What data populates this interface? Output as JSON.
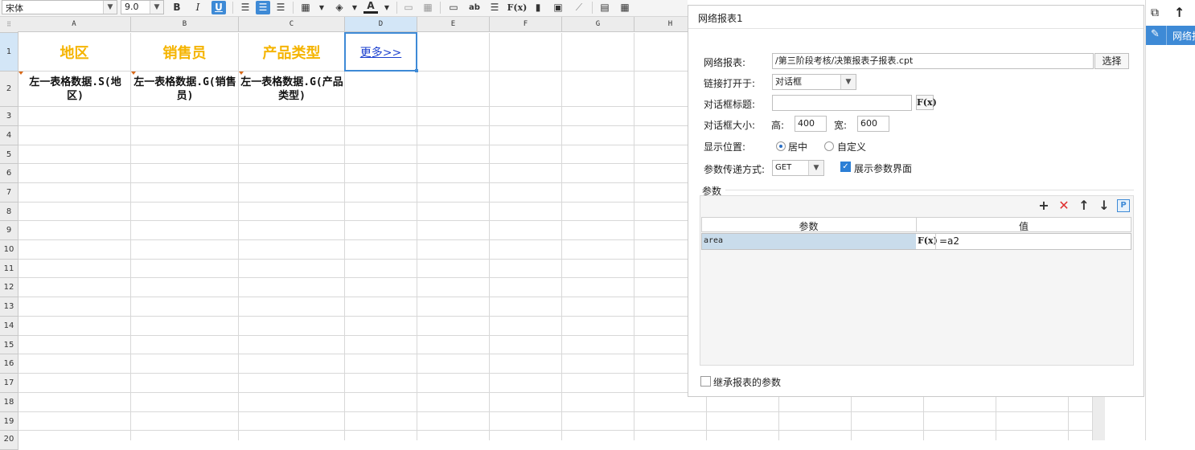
{
  "toolbar": {
    "font_name": "宋体",
    "font_size": "9.0",
    "bold": "B",
    "italic": "I",
    "underline": "U",
    "text_color_glyph": "A",
    "fx": "F(x)",
    "ab": "ab"
  },
  "grid": {
    "columns": [
      "A",
      "B",
      "C",
      "D",
      "E",
      "F",
      "G",
      "H"
    ],
    "rows": [
      "1",
      "2",
      "3",
      "4",
      "5",
      "6",
      "7",
      "8",
      "9",
      "10",
      "11",
      "12",
      "13",
      "14",
      "15",
      "16",
      "17",
      "18",
      "19",
      "20"
    ],
    "row1": [
      "地区",
      "销售员",
      "产品类型"
    ],
    "row1_link": "更多>>",
    "row2": [
      "左一表格数据.S(地区)",
      "左一表格数据.G(销售员)",
      "左一表格数据.G(产品类型)"
    ]
  },
  "panel": {
    "title": "网络报表1",
    "report_label": "网络报表:",
    "report_path": "/第三阶段考核/决策报表子报表.cpt",
    "choose_button": "选择",
    "open_in_label": "链接打开于:",
    "open_in_value": "对话框",
    "dialog_title_label": "对话框标题:",
    "dialog_title_value": "",
    "fx": "F(x)",
    "dialog_size_label": "对话框大小:",
    "height_label": "高:",
    "height_value": "400",
    "width_label": "宽:",
    "width_value": "600",
    "position_label": "显示位置:",
    "position_center": "居中",
    "position_custom": "自定义",
    "param_mode_label": "参数传递方式:",
    "param_mode_value": "GET",
    "show_param_ui": "展示参数界面",
    "params_section": "参数",
    "params_col_param": "参数",
    "params_col_value": "值",
    "params_rows": [
      {
        "name": "area",
        "value": "=a2"
      }
    ],
    "inherit_params": "继承报表的参数"
  },
  "right_panel": {
    "item_label": "网络报"
  },
  "colors": {
    "accent_blue": "#3e8ad6",
    "header_text_gold": "#f5b400",
    "link_blue": "#1a3fcf",
    "param_row_bg": "#c9dceb"
  }
}
